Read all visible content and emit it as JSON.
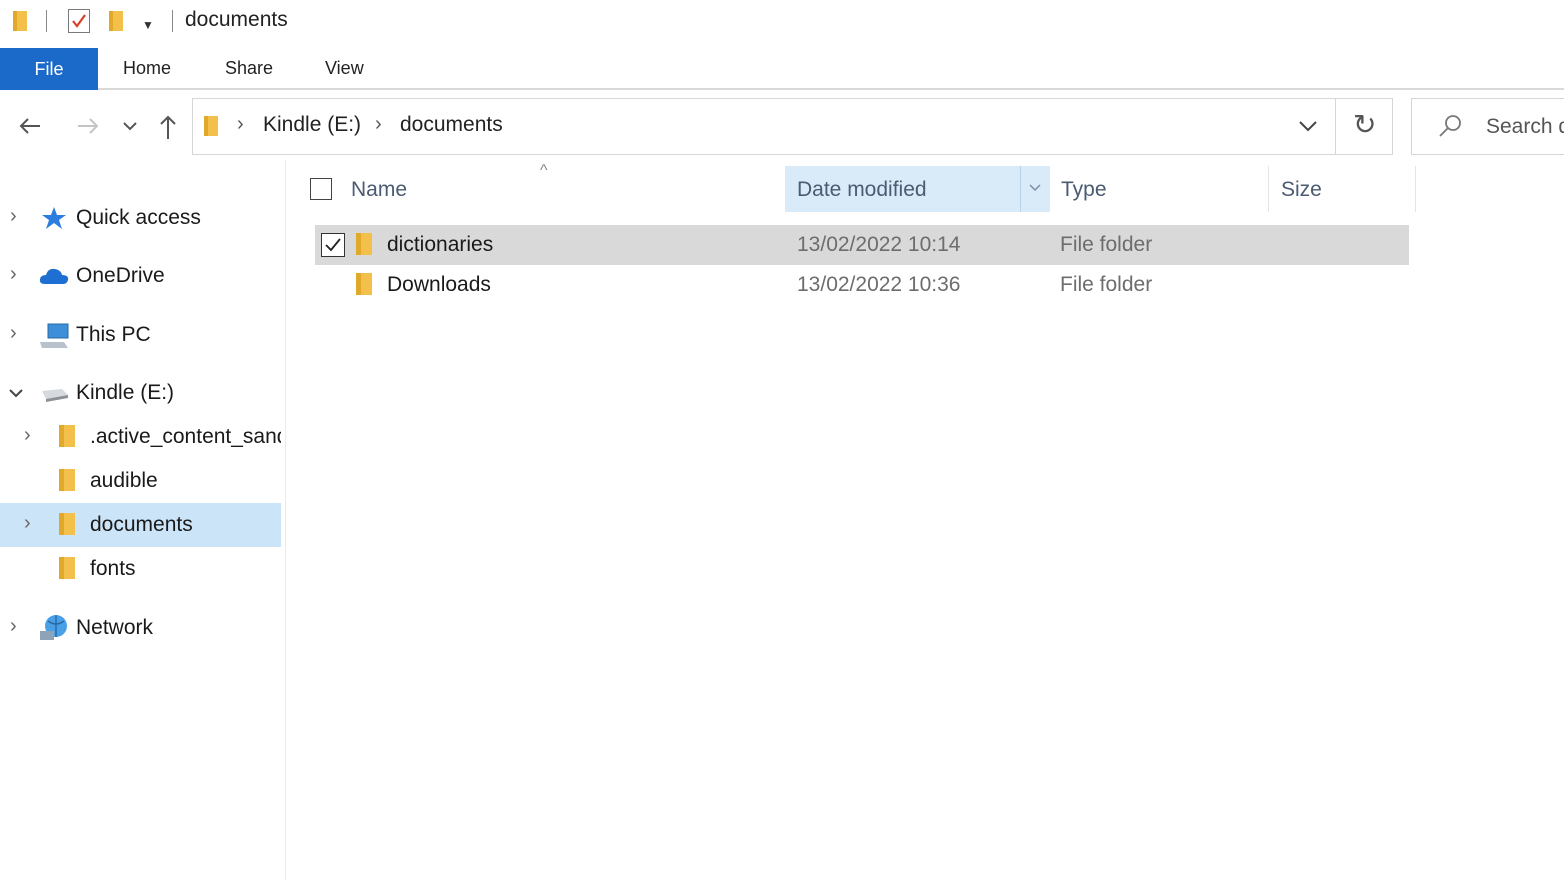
{
  "window": {
    "title": "documents"
  },
  "ribbon": {
    "tabs": [
      "File",
      "Home",
      "Share",
      "View"
    ]
  },
  "address_bar": {
    "crumbs": [
      "Kindle (E:)",
      "documents"
    ],
    "search_placeholder": "Search d"
  },
  "nav_pane": {
    "items": [
      {
        "label": "Quick access",
        "icon": "quick-access-star-icon",
        "expand": "collapsed"
      },
      {
        "label": "OneDrive",
        "icon": "onedrive-cloud-icon",
        "expand": "collapsed"
      },
      {
        "label": "This PC",
        "icon": "this-pc-icon",
        "expand": "collapsed"
      },
      {
        "label": "Kindle (E:)",
        "icon": "drive-icon",
        "expand": "expanded"
      },
      {
        "label": ".active_content_sandbox",
        "icon": "folder-icon",
        "expand": "collapsed"
      },
      {
        "label": "audible",
        "icon": "folder-icon",
        "expand": "none"
      },
      {
        "label": "documents",
        "icon": "folder-icon",
        "expand": "collapsed",
        "selected": true
      },
      {
        "label": "fonts",
        "icon": "folder-icon",
        "expand": "none"
      },
      {
        "label": "Network",
        "icon": "network-icon",
        "expand": "collapsed"
      }
    ]
  },
  "file_list": {
    "columns": [
      "Name",
      "Date modified",
      "Type",
      "Size"
    ],
    "sorted_column": "Name",
    "rows": [
      {
        "name": "dictionaries",
        "date_modified": "13/02/2022 10:14",
        "type": "File folder",
        "size": "",
        "selected": true,
        "checked": true
      },
      {
        "name": "Downloads",
        "date_modified": "13/02/2022 10:36",
        "type": "File folder",
        "size": "",
        "selected": false,
        "checked": false
      }
    ]
  },
  "colors": {
    "file_tab": "#1b6ac9",
    "nav_selected": "#cce4f7",
    "row_selected": "#d9d9d9",
    "folder": "#f3c14b"
  }
}
